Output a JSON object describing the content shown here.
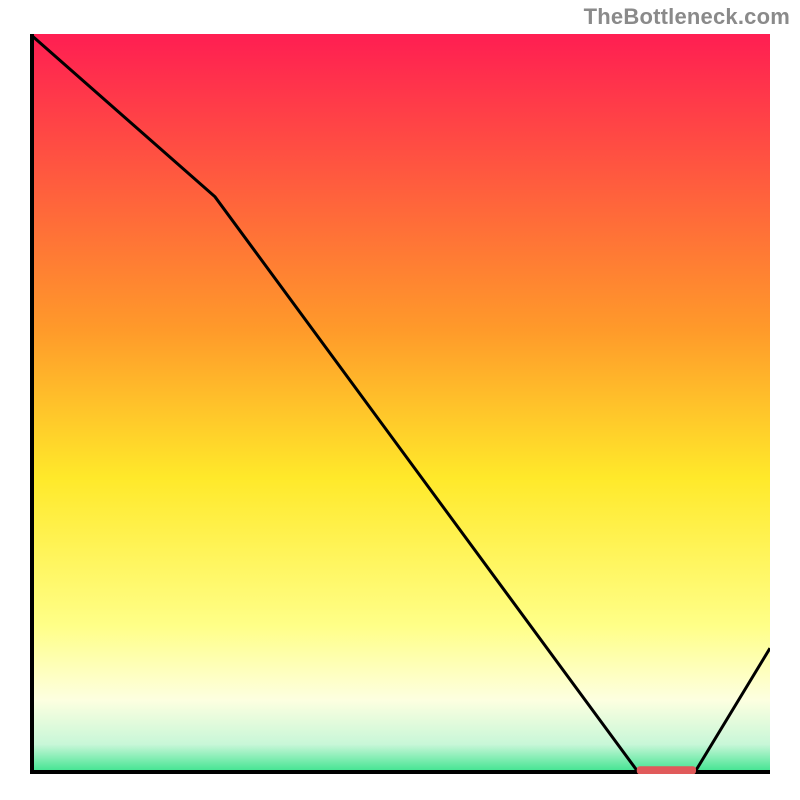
{
  "attribution": "TheBottleneck.com",
  "chart_data": {
    "type": "line",
    "title": "",
    "xlabel": "",
    "ylabel": "",
    "xlim": [
      0,
      100
    ],
    "ylim": [
      0,
      100
    ],
    "grid": false,
    "series": [
      {
        "name": "curve",
        "x": [
          0,
          25,
          82,
          90,
          100
        ],
        "y": [
          100,
          78,
          0.5,
          0.5,
          17
        ]
      }
    ],
    "marker": {
      "name": "highlight-segment",
      "x_start": 82,
      "x_end": 90,
      "y": 0.5,
      "color": "#e05a5a"
    },
    "gradient_stops": [
      {
        "pos": 0.0,
        "color": "#ff1e52"
      },
      {
        "pos": 0.4,
        "color": "#ff9a2a"
      },
      {
        "pos": 0.6,
        "color": "#ffe92a"
      },
      {
        "pos": 0.8,
        "color": "#ffff88"
      },
      {
        "pos": 0.9,
        "color": "#fdffe0"
      },
      {
        "pos": 0.96,
        "color": "#c8f7d8"
      },
      {
        "pos": 1.0,
        "color": "#35e28a"
      }
    ],
    "axis_color": "#000000",
    "line_color": "#000000"
  }
}
